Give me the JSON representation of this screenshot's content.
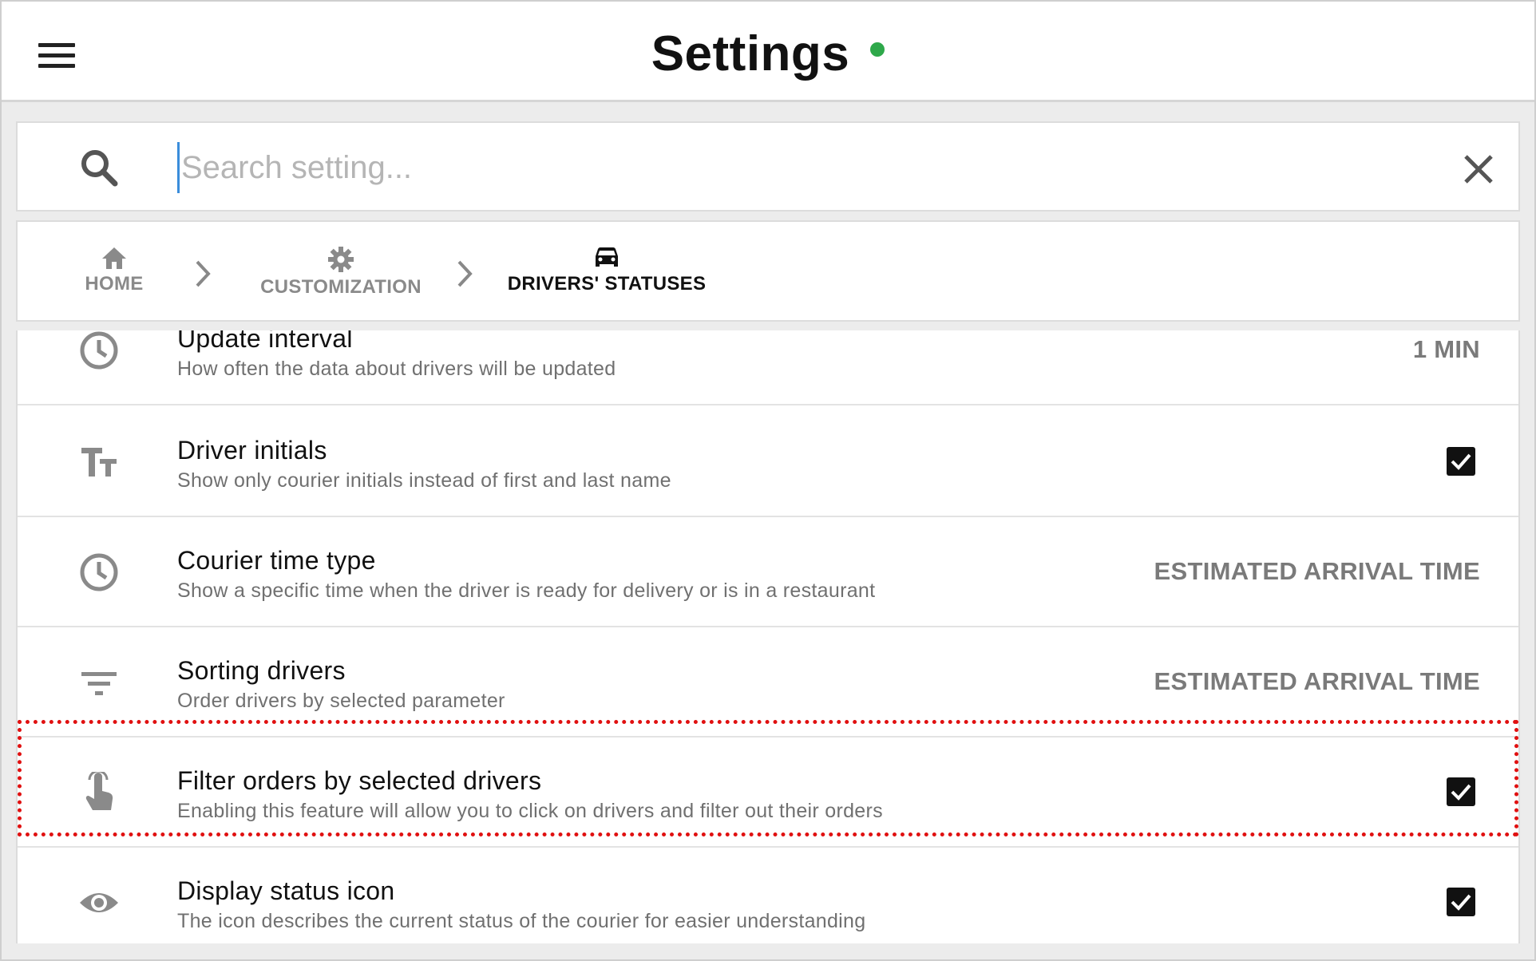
{
  "header": {
    "title": "Settings",
    "status_color": "#2ea84a"
  },
  "search": {
    "placeholder": "Search setting..."
  },
  "breadcrumb": {
    "items": [
      {
        "label": "HOME",
        "icon": "home-icon"
      },
      {
        "label": "CUSTOMIZATION",
        "icon": "gear-icon"
      },
      {
        "label": "DRIVERS' STATUSES",
        "icon": "car-icon"
      }
    ]
  },
  "settings": [
    {
      "title": "Update interval",
      "description": "How often the data about drivers will be updated",
      "value": "1 MIN",
      "icon": "clock-icon"
    },
    {
      "title": "Driver initials",
      "description": "Show only courier initials instead of first and last name",
      "checked": true,
      "icon": "text-size-icon"
    },
    {
      "title": "Courier time type",
      "description": "Show a specific time when the driver is ready for delivery or is in a restaurant",
      "value": "ESTIMATED ARRIVAL TIME",
      "icon": "clock-icon"
    },
    {
      "title": "Sorting drivers",
      "description": "Order drivers by selected parameter",
      "value": "ESTIMATED ARRIVAL TIME",
      "icon": "sort-icon"
    },
    {
      "title": "Filter orders by selected drivers",
      "description": "Enabling this feature will allow you to click on drivers and filter out their orders",
      "checked": true,
      "icon": "touch-icon"
    },
    {
      "title": "Display status icon",
      "description": "The icon describes the current status of the courier for easier understanding",
      "checked": true,
      "icon": "eye-icon"
    }
  ],
  "colors": {
    "highlight": "#e01010",
    "accent_text": "#7a7a7a"
  }
}
